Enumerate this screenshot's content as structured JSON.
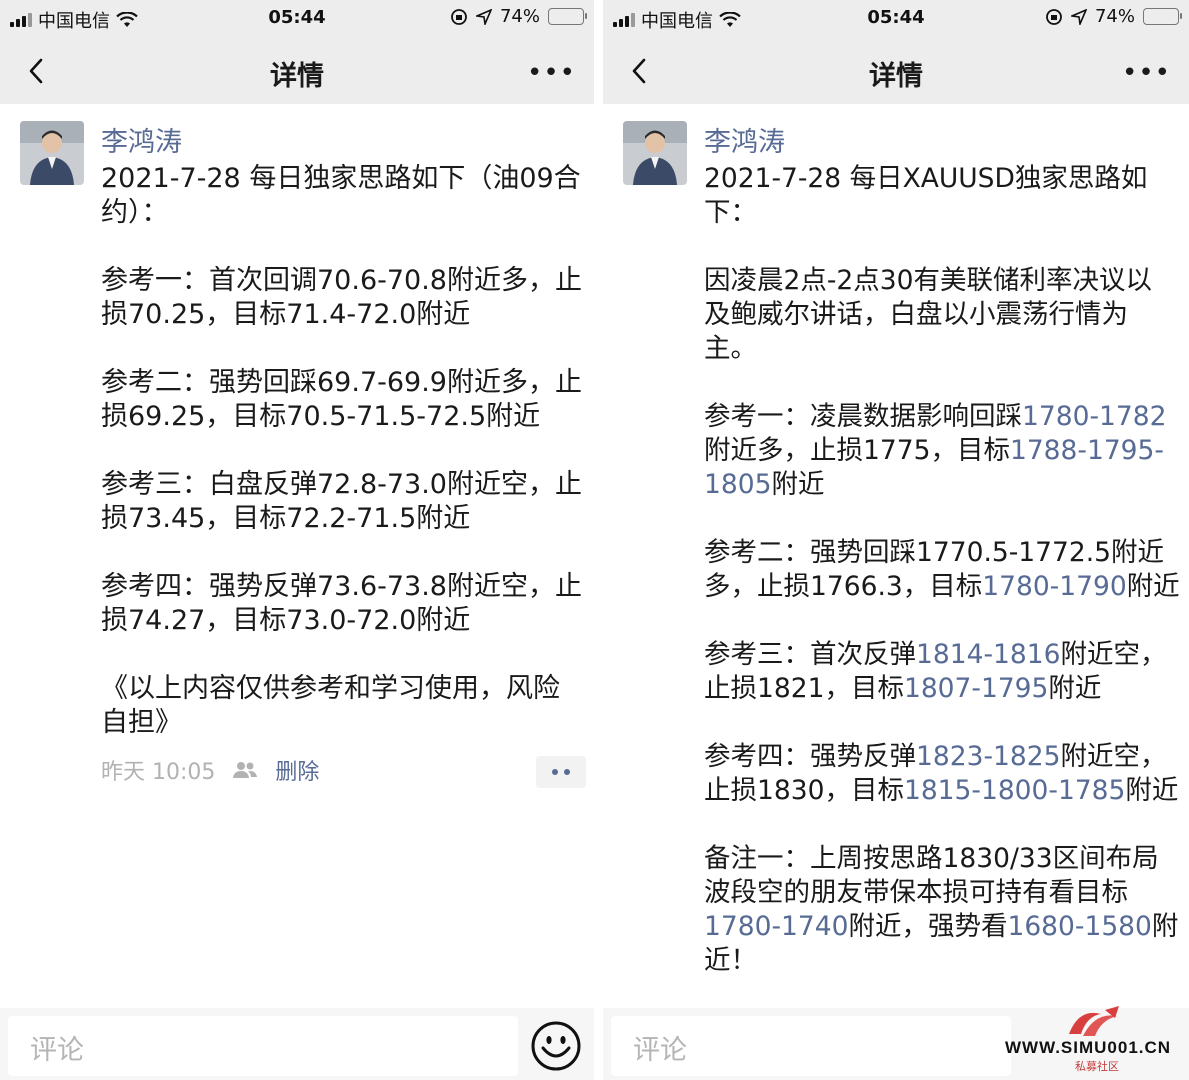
{
  "status": {
    "carrier": "中国电信",
    "time": "05:44",
    "battery": "74%",
    "battery_level": 0.74
  },
  "left": {
    "nav_title": "详情",
    "author": "李鸿涛",
    "lines": [
      "2021-7-28  每日独家思路如下（油09合",
      "约）：",
      "参考一：首次回调70.6-70.8附近多，止",
      "损70.25，目标71.4-72.0附近",
      "参考二：强势回踩69.7-69.9附近多，止",
      "损69.25，目标70.5-71.5-72.5附近",
      "参考三：白盘反弹72.8-73.0附近空，止",
      "损73.45，目标72.2-71.5附近",
      "参考四：强势反弹73.6-73.8附近空，止",
      "损74.27，目标73.0-72.0附近",
      "《以上内容仅供参考和学习使用，风险",
      "自担》"
    ],
    "timestamp": "昨天 10:05",
    "delete_label": "删除",
    "comment_placeholder": "评论"
  },
  "right": {
    "nav_title": "详情",
    "author": "李鸿涛",
    "line1": "2021-7-28 每日XAUUSD独家思路如",
    "line2": "下：",
    "line3": "因凌晨2点-2点30有美联储利率决议以",
    "line4": "及鲍威尔讲话，白盘以小震荡行情为",
    "line5": "主。",
    "r1a": "参考一：凌晨数据影响回踩",
    "r1b": "1780-1782",
    "r1c": "附近多，止损1775，目标",
    "r1d": "1788-1795-",
    "r1e": "1805",
    "r1f": "附近",
    "r2a": "参考二：强势回踩1770.5-1772.5附近",
    "r2b": "多，止损1766.3，目标",
    "r2c": "1780-1790",
    "r2d": "附近",
    "r3a": "参考三：首次反弹",
    "r3b": "1814-1816",
    "r3c": "附近空，",
    "r3d": "止损1821，目标",
    "r3e": "1807-1795",
    "r3f": "附近",
    "r4a": "参考四：强势反弹",
    "r4b": "1823-1825",
    "r4c": "附近空，",
    "r4d": "止损1830，目标",
    "r4e": "1815-1800-1785",
    "r4f": "附近",
    "n1": "备注一：上周按思路1830/33区间布局",
    "n2": "波段空的朋友带保本损可持有看目标",
    "n3a": "1780-1740",
    "n3b": "附近，强势看",
    "n3c": "1680-1580",
    "n3d": "附",
    "n4": "近！",
    "comment_placeholder": "评论"
  },
  "watermark": {
    "site": "WWW.SIMU001.CN",
    "cn": "私募社区"
  },
  "colors": {
    "link": "#576b95",
    "bar_bg": "#ededed",
    "battery": "#2fc24a"
  }
}
